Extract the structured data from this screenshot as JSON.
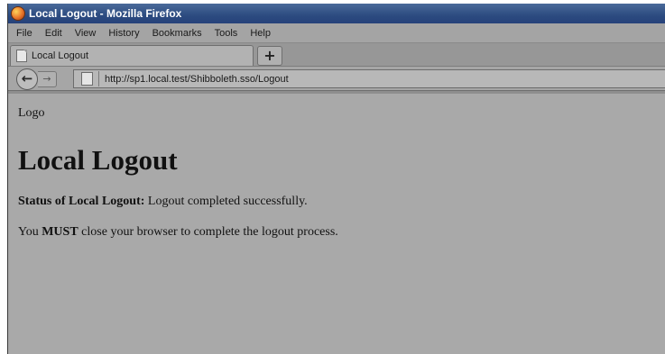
{
  "window": {
    "title": "Local Logout - Mozilla Firefox"
  },
  "menu": {
    "items": [
      "File",
      "Edit",
      "View",
      "History",
      "Bookmarks",
      "Tools",
      "Help"
    ]
  },
  "tab": {
    "label": "Local Logout",
    "new_tab": "+"
  },
  "nav": {
    "back": "←",
    "forward": "→",
    "url": "http://sp1.local.test/Shibboleth.sso/Logout"
  },
  "page": {
    "logo": "Logo",
    "heading": "Local Logout",
    "status_label": "Status of Local Logout:",
    "status_text": " Logout completed successfully.",
    "note_prefix": "You ",
    "note_emphasis": "MUST",
    "note_suffix": " close your browser to complete the logout process."
  },
  "icons": [
    "firefox-logo-icon",
    "page-icon",
    "back-arrow-icon",
    "forward-arrow-icon",
    "new-tab-icon"
  ]
}
